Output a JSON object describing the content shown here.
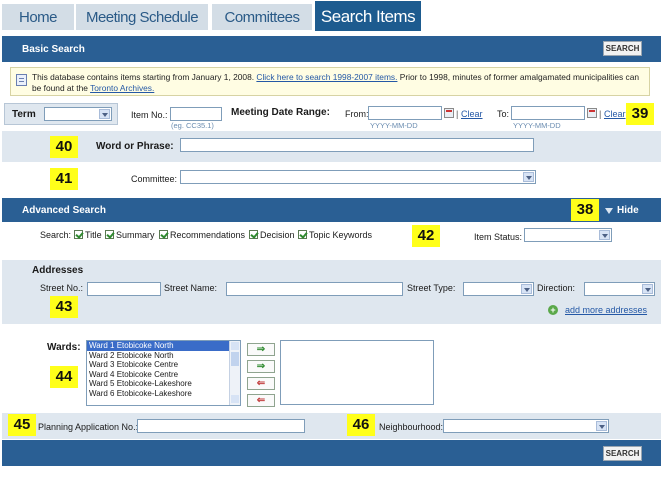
{
  "tabs": [
    "Home",
    "Meeting Schedule",
    "Committees",
    "Search Items"
  ],
  "basic_search": {
    "title": "Basic Search",
    "button": "SEARCH"
  },
  "notice": {
    "text1": "This database contains items starting from January 1, 2008. ",
    "link1": "Click here to search 1998-2007 items.",
    "text2": " Prior to 1998, minutes of former amalgamated municipalities can be found at the ",
    "link2": "Toronto Archives."
  },
  "term": {
    "label": "Term"
  },
  "item_no": {
    "label": "Item No.:",
    "hint": "(eg. CC35.1)"
  },
  "date_range": {
    "label": "Meeting Date Range:",
    "from_label": "From:",
    "to_label": "To:",
    "format_hint": "YYYY-MM-DD",
    "clear_label": "Clear",
    "separator": "|"
  },
  "word_phrase": {
    "label": "Word or Phrase:"
  },
  "committee": {
    "label": "Committee:"
  },
  "advanced_search": {
    "title": "Advanced Search",
    "hide_label": "Hide"
  },
  "search_in": {
    "label": "Search:",
    "options": [
      "Title",
      "Summary",
      "Recommendations",
      "Decision",
      "Topic Keywords"
    ]
  },
  "item_status": {
    "label": "Item Status:"
  },
  "addresses": {
    "title": "Addresses",
    "street_no": "Street No.:",
    "street_name": "Street Name:",
    "street_type": "Street Type:",
    "direction": "Direction:",
    "add_more": "add more addresses"
  },
  "wards": {
    "label": "Wards:",
    "items": [
      "Ward 1 Etobicoke North",
      "Ward 2 Etobicoke North",
      "Ward 3 Etobicoke Centre",
      "Ward 4 Etobicoke Centre",
      "Ward 5 Etobicoke-Lakeshore",
      "Ward 6 Etobicoke-Lakeshore"
    ],
    "add_arrow": "⇒",
    "remove_arrow": "⇐"
  },
  "planning": {
    "label": "Planning Application No.:"
  },
  "neighbourhood": {
    "label": "Neighbourhood:"
  },
  "footer": {
    "button": "SEARCH"
  },
  "markers": [
    "38",
    "39",
    "40",
    "41",
    "42",
    "43",
    "44",
    "45",
    "46"
  ],
  "colors": {
    "bar": "#2a5f94",
    "active_tab": "#1d5b8f",
    "tab": "#d3dde6",
    "panel": "#dfe7ef",
    "marker": "#ffff1a"
  }
}
